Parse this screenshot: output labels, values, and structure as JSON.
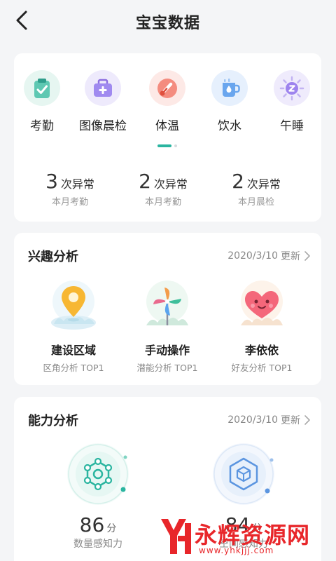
{
  "header": {
    "title": "宝宝数据"
  },
  "theme": {
    "accent": "#2bb5a0",
    "text": "#222222",
    "muted": "#999999",
    "watermark": "#e8262a"
  },
  "categories": [
    {
      "label": "考勤",
      "icon": "attendance-clipboard-icon"
    },
    {
      "label": "图像晨检",
      "icon": "medical-kit-icon"
    },
    {
      "label": "体温",
      "icon": "thermometer-icon"
    },
    {
      "label": "饮水",
      "icon": "water-cup-icon"
    },
    {
      "label": "午睡",
      "icon": "sleep-z-icon"
    }
  ],
  "pager": {
    "active_index": 0,
    "pages": 2
  },
  "stats": [
    {
      "count": "3",
      "unit": "次异常",
      "desc": "本月考勤"
    },
    {
      "count": "2",
      "unit": "次异常",
      "desc": "本月考勤"
    },
    {
      "count": "2",
      "unit": "次异常",
      "desc": "本月晨检"
    }
  ],
  "interest": {
    "title": "兴趣分析",
    "date": "2020/3/10",
    "update_label": "更新",
    "items": [
      {
        "name": "建设区域",
        "sub": "区角分析 TOP1",
        "icon": "location-pin-icon"
      },
      {
        "name": "手动操作",
        "sub": "潜能分析 TOP1",
        "icon": "pinwheel-icon"
      },
      {
        "name": "李依依",
        "sub": "好友分析 TOP1",
        "icon": "heart-face-icon"
      }
    ]
  },
  "ability": {
    "title": "能力分析",
    "date": "2020/3/10",
    "update_label": "更新",
    "items": [
      {
        "score": "86",
        "unit": "分",
        "name": "数量感知力",
        "icon": "molecule-hexagon-icon"
      },
      {
        "score": "84",
        "unit": "分",
        "name": "空间感知力",
        "icon": "cube-icon"
      }
    ]
  },
  "watermark": {
    "text": "永辉资源网",
    "url": "www.yhkjjj.com"
  }
}
